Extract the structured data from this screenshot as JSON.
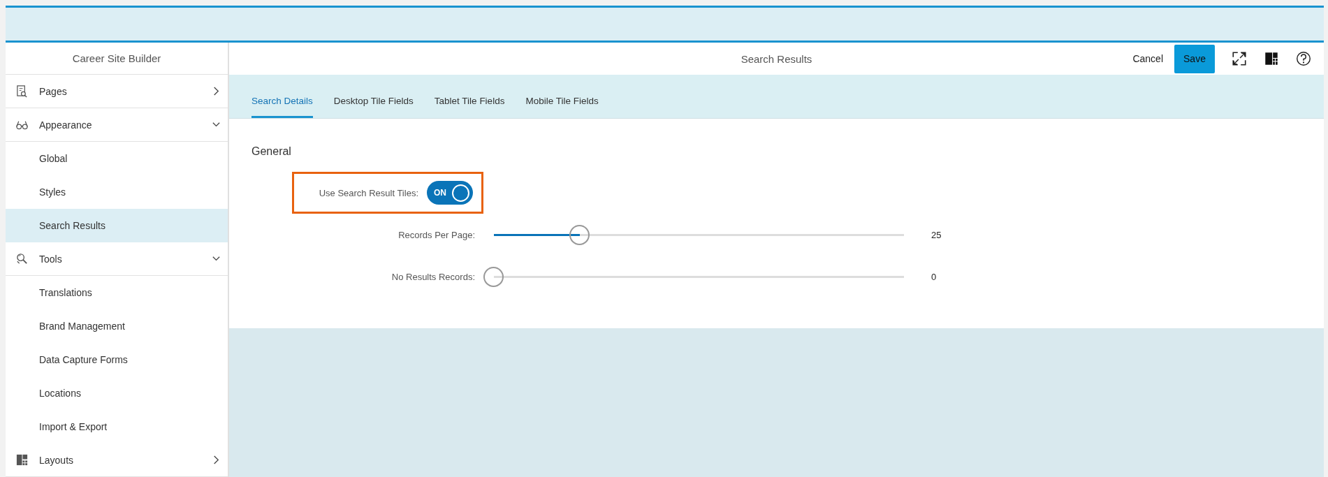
{
  "sidebar": {
    "title": "Career Site Builder",
    "items": [
      {
        "label": "Pages",
        "expanded": false,
        "selected": false
      },
      {
        "label": "Appearance",
        "expanded": true,
        "selected": false,
        "children": [
          {
            "label": "Global",
            "selected": false
          },
          {
            "label": "Styles",
            "selected": false
          },
          {
            "label": "Search Results",
            "selected": true
          }
        ]
      },
      {
        "label": "Tools",
        "expanded": true,
        "selected": false,
        "children": [
          {
            "label": "Translations",
            "selected": false
          },
          {
            "label": "Brand Management",
            "selected": false
          },
          {
            "label": "Data Capture Forms",
            "selected": false
          },
          {
            "label": "Locations",
            "selected": false
          },
          {
            "label": "Import & Export",
            "selected": false
          }
        ]
      },
      {
        "label": "Layouts",
        "expanded": false,
        "selected": false
      }
    ]
  },
  "header": {
    "title": "Search Results",
    "cancel": "Cancel",
    "save": "Save"
  },
  "tabs": [
    {
      "label": "Search Details",
      "selected": true
    },
    {
      "label": "Desktop Tile Fields",
      "selected": false
    },
    {
      "label": "Tablet Tile Fields",
      "selected": false
    },
    {
      "label": "Mobile Tile Fields",
      "selected": false
    }
  ],
  "section": {
    "title": "General",
    "fields": [
      {
        "kind": "toggle",
        "label": "Use Search Result Tiles:",
        "on": true,
        "text": "ON",
        "highlighted": true
      },
      {
        "kind": "slider",
        "label": "Records Per Page:",
        "level": 0.21,
        "reading": "25"
      },
      {
        "kind": "slider",
        "label": "No Results Records:",
        "level": 0,
        "reading": "0"
      }
    ]
  }
}
